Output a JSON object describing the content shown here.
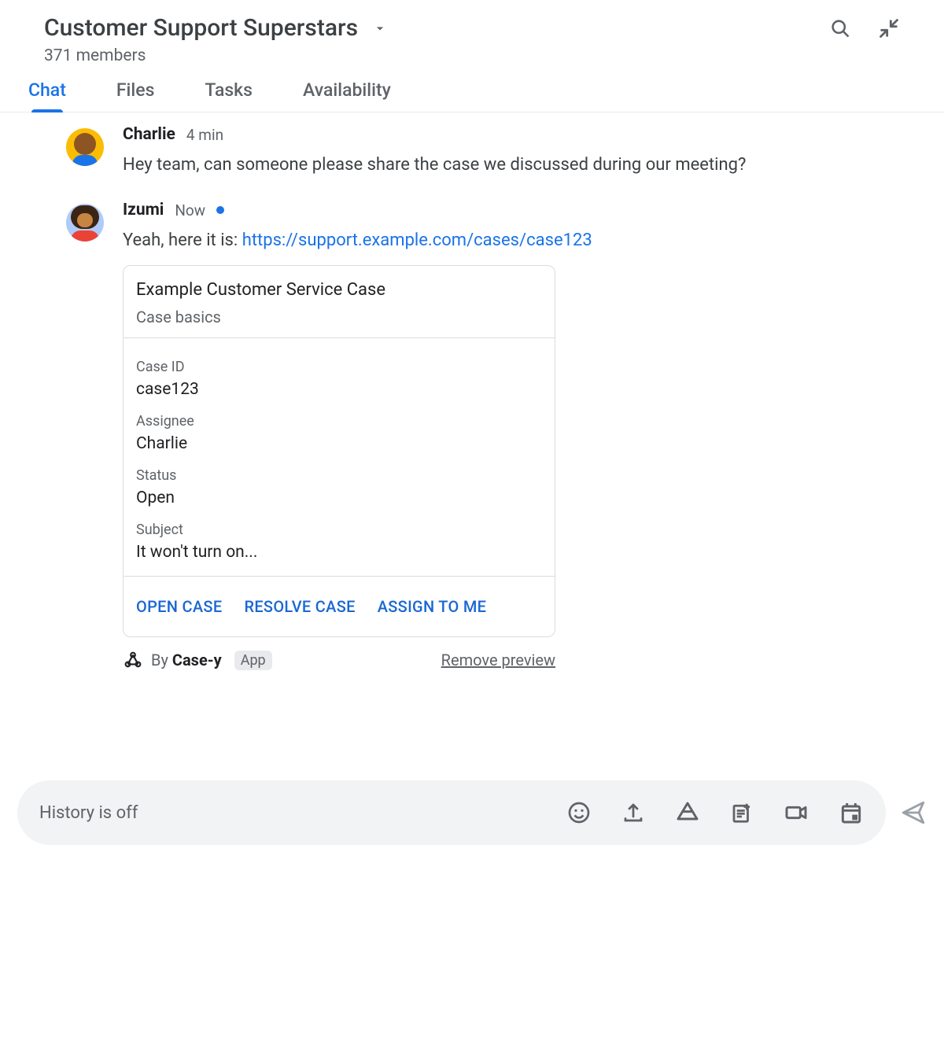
{
  "header": {
    "space_title": "Customer Support Superstars",
    "member_count": "371 members"
  },
  "tabs": [
    {
      "label": "Chat",
      "active": true
    },
    {
      "label": "Files",
      "active": false
    },
    {
      "label": "Tasks",
      "active": false
    },
    {
      "label": "Availability",
      "active": false
    }
  ],
  "messages": [
    {
      "author": "Charlie",
      "timestamp": "4 min",
      "new": false,
      "text": "Hey team, can someone please share the case we discussed during our meeting?"
    },
    {
      "author": "Izumi",
      "timestamp": "Now",
      "new": true,
      "text_prefix": "Yeah, here it is: ",
      "link_text": "https://support.example.com/cases/case123"
    }
  ],
  "card": {
    "title": "Example Customer Service Case",
    "subtitle": "Case basics",
    "fields": [
      {
        "label": "Case ID",
        "value": "case123"
      },
      {
        "label": "Assignee",
        "value": "Charlie"
      },
      {
        "label": "Status",
        "value": "Open"
      },
      {
        "label": "Subject",
        "value": "It won't turn on..."
      }
    ],
    "actions": [
      {
        "label": "OPEN CASE"
      },
      {
        "label": "RESOLVE CASE"
      },
      {
        "label": "ASSIGN TO ME"
      }
    ]
  },
  "preview_footer": {
    "by_prefix": "By ",
    "app_name": "Case-y",
    "app_chip": "App",
    "remove_link": "Remove preview"
  },
  "composer": {
    "placeholder": "History is off"
  }
}
